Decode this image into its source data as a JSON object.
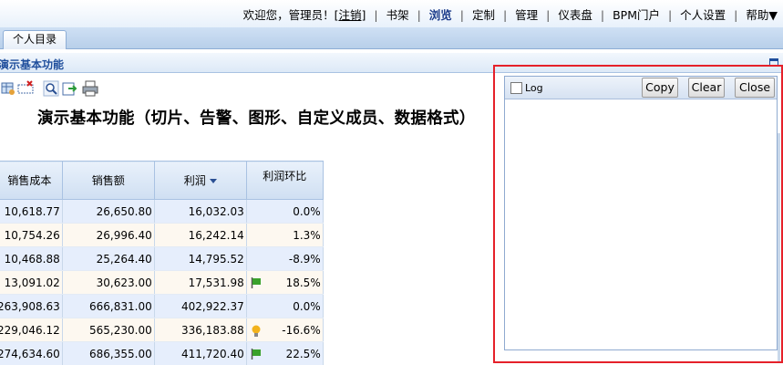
{
  "header": {
    "welcome": "欢迎您，管理员！[",
    "logout": "注销",
    "welcome_end": "]",
    "nav": [
      "书架",
      "浏览",
      "定制",
      "管理",
      "仪表盘",
      "BPM门户",
      "个人设置",
      "帮助▼"
    ],
    "active_nav": "浏览"
  },
  "tabs": {
    "personal": "个人目录"
  },
  "panel": {
    "title": "演示基本功能"
  },
  "report": {
    "title": "演示基本功能（切片、告警、图形、自定义成员、数据格式）",
    "columns": [
      "销售成本",
      "销售额",
      "利润",
      "利润环比"
    ],
    "rows": [
      {
        "cost": "10,618.77",
        "sales": "26,650.80",
        "profit": "16,032.03",
        "ratio": "0.0%",
        "icon": ""
      },
      {
        "cost": "10,754.26",
        "sales": "26,996.40",
        "profit": "16,242.14",
        "ratio": "1.3%",
        "icon": ""
      },
      {
        "cost": "10,468.88",
        "sales": "25,264.40",
        "profit": "14,795.52",
        "ratio": "-8.9%",
        "icon": ""
      },
      {
        "cost": "13,091.02",
        "sales": "30,623.00",
        "profit": "17,531.98",
        "ratio": "18.5%",
        "icon": "flag-icon"
      },
      {
        "cost": "263,908.63",
        "sales": "666,831.00",
        "profit": "402,922.37",
        "ratio": "0.0%",
        "icon": ""
      },
      {
        "cost": "229,046.12",
        "sales": "565,230.00",
        "profit": "336,183.88",
        "ratio": "-16.6%",
        "icon": "bulb-icon"
      },
      {
        "cost": "274,634.60",
        "sales": "686,355.00",
        "profit": "411,720.40",
        "ratio": "22.5%",
        "icon": "flag-icon"
      }
    ]
  },
  "log": {
    "label": "Log",
    "copy": "Copy",
    "clear": "Clear",
    "close": "Close"
  },
  "colors": {
    "highlight": "#e5212a",
    "flag": "#3aa12b",
    "bulb": "#f2b21b"
  }
}
